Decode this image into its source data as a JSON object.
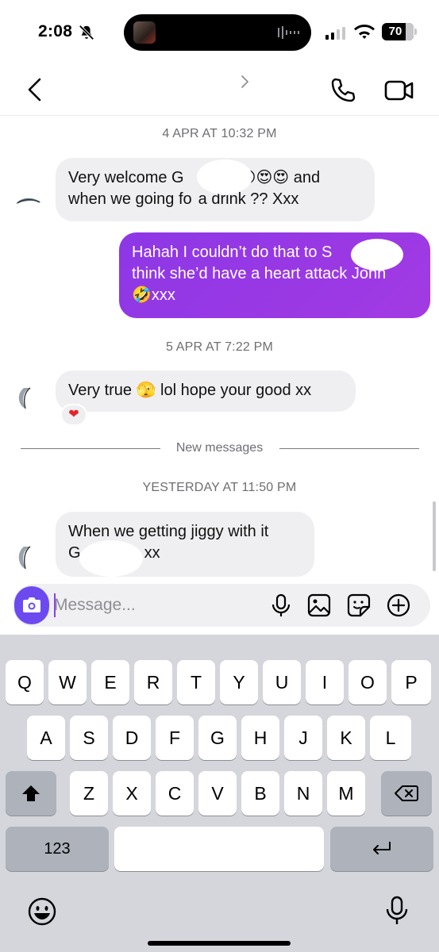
{
  "status_bar": {
    "time": "2:08",
    "battery": "70"
  },
  "chat": {
    "timestamps": [
      "4 APR AT 10:32 PM",
      "5 APR AT 7:22 PM",
      "YESTERDAY AT 11:50 PM"
    ],
    "messages": [
      {
        "from": "them",
        "line1": "Very welcome G",
        "line1b": "😍😍😍 and",
        "line2a": "when we going fo",
        "line2b": "a drink ?? Xxx"
      },
      {
        "from": "me",
        "line1": "Hahah I couldn’t do that to S",
        "line1b": "I",
        "line2": "think she’d have a heart attack John",
        "line3": "🤣xxx"
      },
      {
        "from": "them",
        "line1": "Very true 🫣 lol hope your good xx",
        "reaction": "❤"
      },
      {
        "from": "them",
        "line1": "When we getting jiggy with it",
        "line2a": "G",
        "line2b": "xx"
      }
    ],
    "divider_label": "New messages"
  },
  "composer": {
    "placeholder": "Message..."
  },
  "keyboard": {
    "row1": [
      "Q",
      "W",
      "E",
      "R",
      "T",
      "Y",
      "U",
      "I",
      "O",
      "P"
    ],
    "row2": [
      "A",
      "S",
      "D",
      "F",
      "G",
      "H",
      "J",
      "K",
      "L"
    ],
    "row3": [
      "Z",
      "X",
      "C",
      "V",
      "B",
      "N",
      "M"
    ],
    "numbers_key": "123"
  },
  "colors": {
    "outgoing_bubble": "#9b38e5",
    "incoming_bubble": "#efeff2",
    "camera_button": "#6d4af0"
  }
}
